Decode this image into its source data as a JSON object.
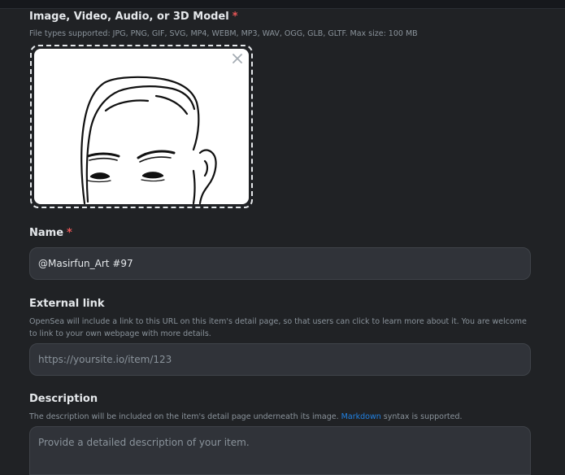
{
  "media": {
    "label": "Image, Video, Audio, or 3D Model",
    "required_mark": "*",
    "helper": "File types supported: JPG, PNG, GIF, SVG, MP4, WEBM, MP3, WAV, OGG, GLB, GLTF. Max size: 100 MB",
    "remove_icon": "close-icon"
  },
  "name": {
    "label": "Name",
    "required_mark": "*",
    "value": "@Masirfun_Art #97"
  },
  "external_link": {
    "label": "External link",
    "helper": "OpenSea will include a link to this URL on this item's detail page, so that users can click to learn more about it. You are welcome to link to your own webpage with more details.",
    "placeholder": "https://yoursite.io/item/123"
  },
  "description": {
    "label": "Description",
    "helper_before": "The description will be included on the item's detail page underneath its image.",
    "helper_link": "Markdown",
    "helper_after": "syntax is supported.",
    "placeholder": "Provide a detailed description of your item."
  },
  "colors": {
    "background": "#202225",
    "field_background": "#303339",
    "required": "#eb5757",
    "link": "#2081e2"
  }
}
